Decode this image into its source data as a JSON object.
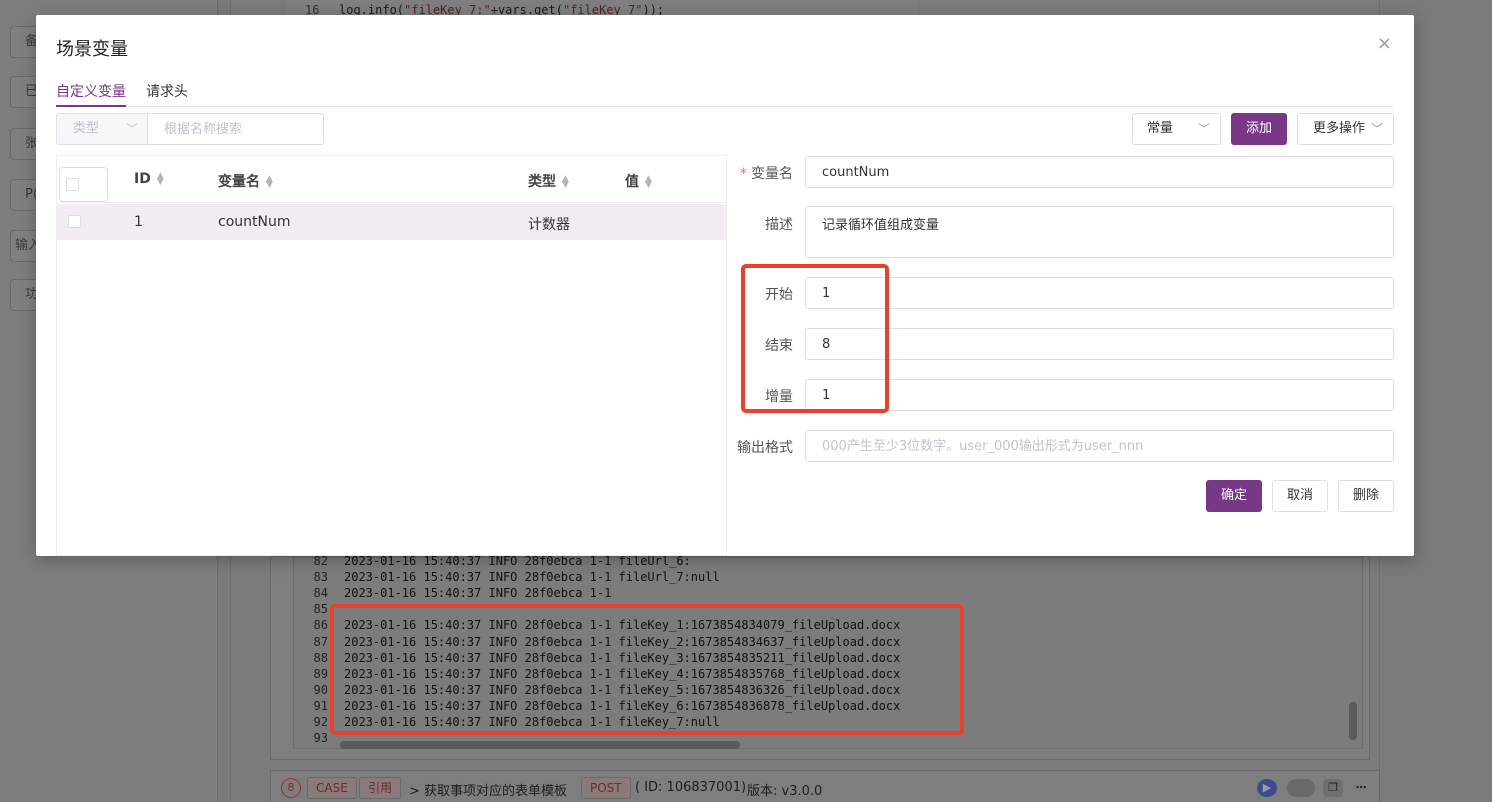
{
  "background": {
    "side_buttons": [
      "备",
      "已",
      "张",
      "P(",
      "输入",
      "功"
    ],
    "code_line": {
      "num": "16",
      "code_prefix": "log.info(",
      "code_str1": "\"fileKey_7:\"",
      "code_mid": "+vars.get(",
      "code_str2": "\"fileKey_7\"",
      "code_suffix": "));"
    },
    "console_lines": [
      {
        "num": "82",
        "text": "2023-01-16 15:40:37 INFO 28f0ebca 1-1 fileUrl_6:"
      },
      {
        "num": "83",
        "text": "2023-01-16 15:40:37 INFO 28f0ebca 1-1 fileUrl_7:null"
      },
      {
        "num": "84",
        "text": "2023-01-16 15:40:37 INFO 28f0ebca 1-1"
      },
      {
        "num": "85",
        "text": ""
      },
      {
        "num": "86",
        "text": "2023-01-16 15:40:37 INFO 28f0ebca 1-1 fileKey_1:1673854834079_fileUpload.docx"
      },
      {
        "num": "87",
        "text": "2023-01-16 15:40:37 INFO 28f0ebca 1-1 fileKey_2:1673854834637_fileUpload.docx"
      },
      {
        "num": "88",
        "text": "2023-01-16 15:40:37 INFO 28f0ebca 1-1 fileKey_3:1673854835211_fileUpload.docx"
      },
      {
        "num": "89",
        "text": "2023-01-16 15:40:37 INFO 28f0ebca 1-1 fileKey_4:1673854835768_fileUpload.docx"
      },
      {
        "num": "90",
        "text": "2023-01-16 15:40:37 INFO 28f0ebca 1-1 fileKey_5:1673854836326_fileUpload.docx"
      },
      {
        "num": "91",
        "text": "2023-01-16 15:40:37 INFO 28f0ebca 1-1 fileKey_6:1673854836878_fileUpload.docx"
      },
      {
        "num": "92",
        "text": "2023-01-16 15:40:37 INFO 28f0ebca 1-1 fileKey_7:null"
      },
      {
        "num": "93",
        "text": ""
      }
    ],
    "bottom_bar": {
      "step_num": "8",
      "case_tag": "CASE",
      "ref_tag": "引用",
      "name": "> 获取事项对应的表单模板",
      "method": "POST",
      "id_text": "( ID: 106837001)",
      "version": "版本: v3.0.0"
    }
  },
  "modal": {
    "title": "场景变量",
    "close": "×",
    "tabs": [
      {
        "label": "自定义变量",
        "active": true
      },
      {
        "label": "请求头",
        "active": false
      }
    ],
    "filter": {
      "type_placeholder": "类型",
      "search_placeholder": "根据名称搜索"
    },
    "toolbar": {
      "const_select": "常量",
      "add_label": "添加",
      "more_label": "更多操作"
    },
    "table": {
      "columns": [
        "ID",
        "变量名",
        "类型",
        "值"
      ],
      "rows": [
        {
          "id": "1",
          "name": "countNum",
          "type": "计数器",
          "value": ""
        }
      ]
    },
    "form": {
      "name_label": "变量名",
      "name_value": "countNum",
      "desc_label": "描述",
      "desc_value": "记录循环值组成变量",
      "start_label": "开始",
      "start_value": "1",
      "end_label": "结束",
      "end_value": "8",
      "step_label": "增量",
      "step_value": "1",
      "format_label": "输出格式",
      "format_placeholder": "000产生至少3位数字。user_000输出形式为user_nnn"
    },
    "actions": {
      "confirm": "确定",
      "cancel": "取消",
      "delete": "删除"
    }
  },
  "colors": {
    "accent": "#783887",
    "highlight": "#e8402a",
    "row_selected": "#f3ecf5"
  },
  "icons": [
    "close-icon",
    "chevron-down-icon",
    "sort-icon",
    "play-icon",
    "toggle-icon",
    "copy-icon",
    "more-icon"
  ]
}
